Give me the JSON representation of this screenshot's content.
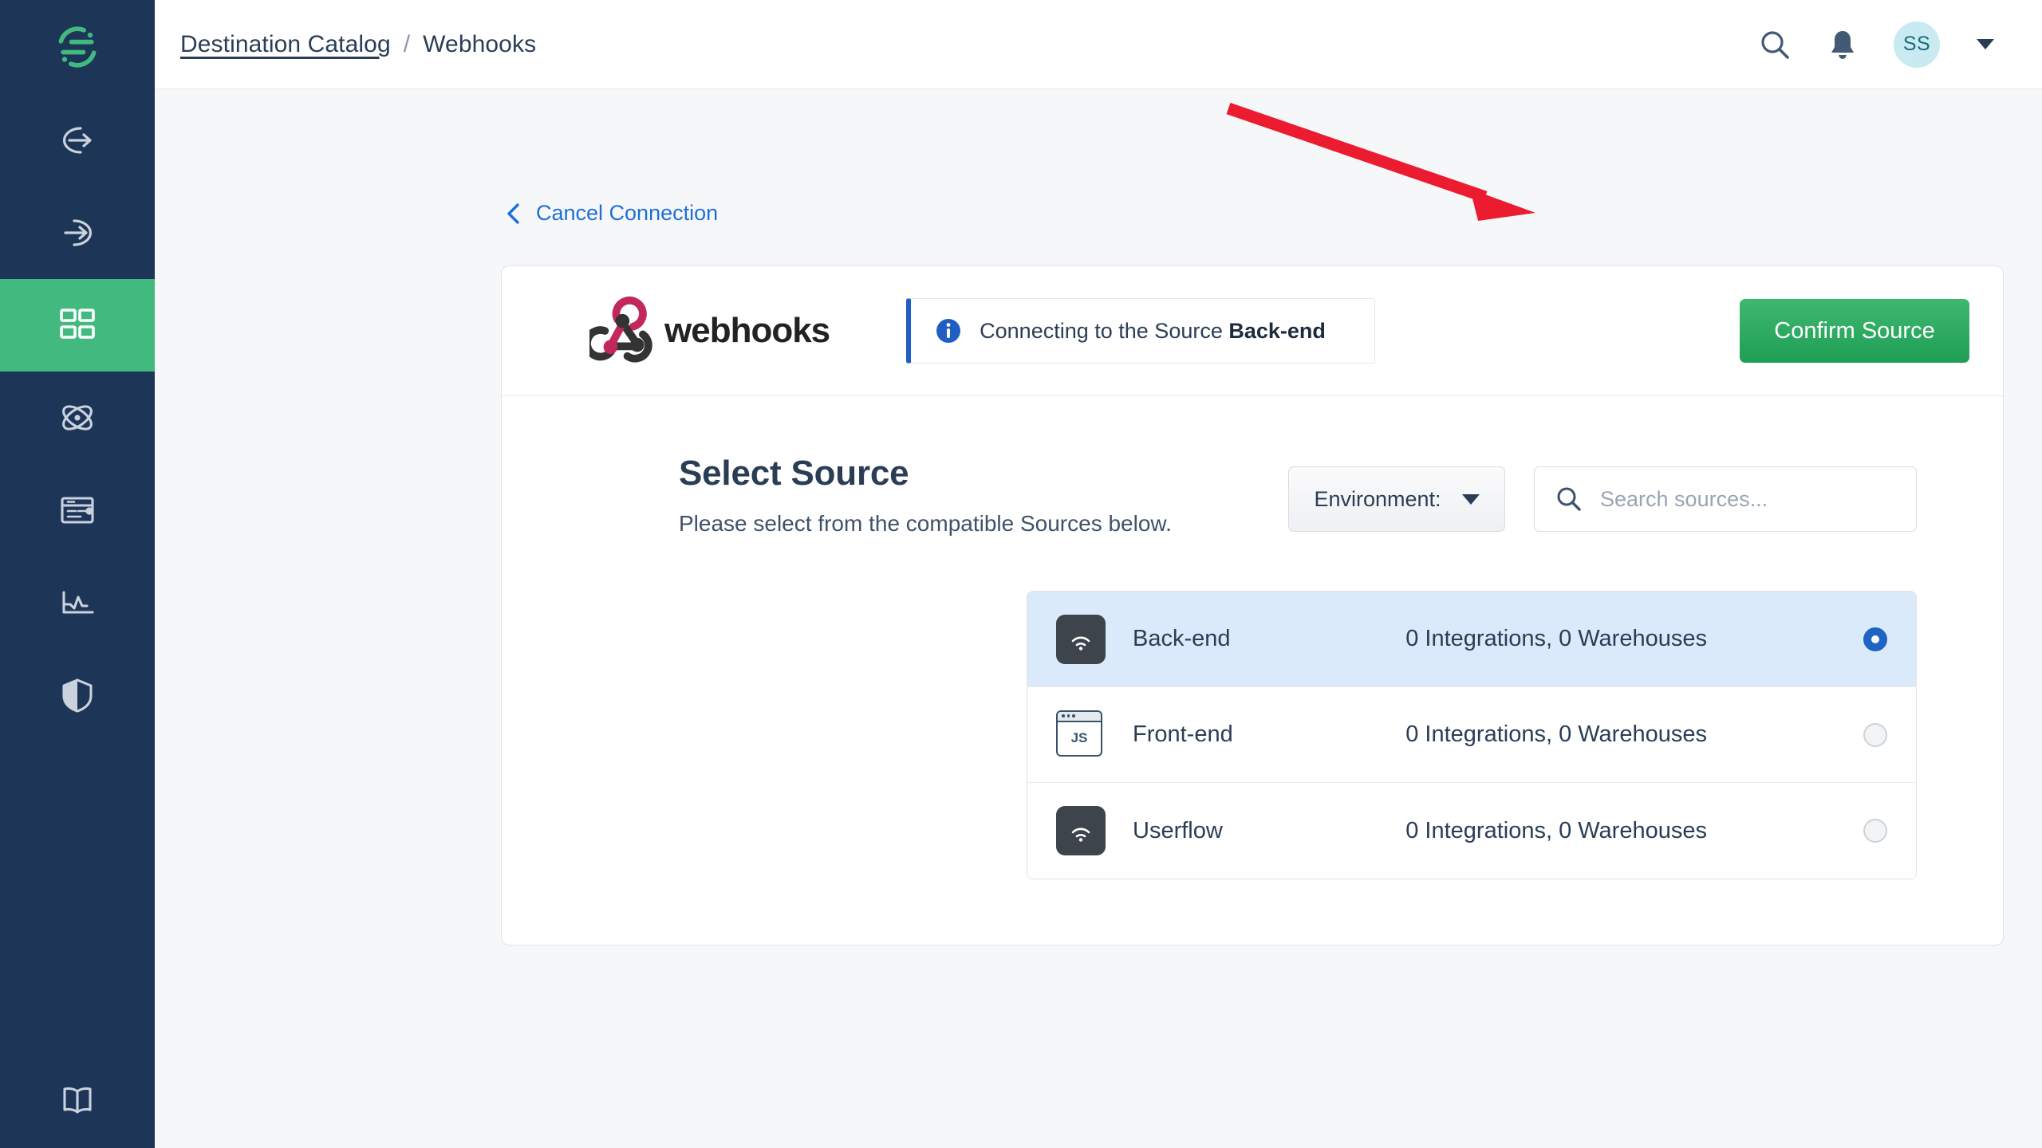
{
  "sidebar": {
    "logo_name": "segment-logo",
    "items": [
      {
        "name": "sources",
        "icon": "arrow-out-circle-icon",
        "active": false
      },
      {
        "name": "destinations",
        "icon": "arrow-in-circle-icon",
        "active": false
      },
      {
        "name": "catalog",
        "icon": "grid-squares-icon",
        "active": true
      },
      {
        "name": "connections",
        "icon": "atom-icon",
        "active": false
      },
      {
        "name": "protocols",
        "icon": "tracking-plan-icon",
        "active": false
      },
      {
        "name": "activity",
        "icon": "line-chart-icon",
        "active": false
      },
      {
        "name": "privacy",
        "icon": "shield-icon",
        "active": false
      }
    ],
    "bottom_item": {
      "name": "docs",
      "icon": "book-icon"
    },
    "active_color": "#41b97f",
    "background_color": "#1d3557"
  },
  "topbar": {
    "breadcrumb": {
      "root_label": "Destination Catalog",
      "separator": "/",
      "current_label": "Webhooks"
    },
    "search_icon": "search-icon",
    "notifications_icon": "bell-icon",
    "avatar_initials": "SS",
    "avatar_bg": "#c9eaf1",
    "avatar_fg": "#1b6b7a",
    "user_menu_icon": "chevron-down-icon"
  },
  "content": {
    "cancel_link_label": "Cancel Connection",
    "cancel_link_color": "#1f6fd8"
  },
  "card": {
    "brand_name": "webhooks",
    "brand_logo_colors": {
      "pink": "#c2285a",
      "dark": "#333333"
    },
    "info_banner": {
      "icon": "info-circle-icon",
      "text_prefix": "Connecting to the Source ",
      "source_name": "Back-end",
      "accent_color": "#1f5fc4"
    },
    "confirm_button_label": "Confirm Source",
    "confirm_button_color": "#2ba35d"
  },
  "select_source": {
    "title": "Select Source",
    "subtitle": "Please select from the compatible Sources below.",
    "environment_filter": {
      "label": "Environment:",
      "icon": "chevron-down-icon"
    },
    "search": {
      "icon": "search-icon",
      "placeholder": "Search sources...",
      "value": ""
    },
    "sources": [
      {
        "name": "Back-end",
        "icon": "server-signal-icon",
        "icon_style": "dark",
        "meta": "0 Integrations, 0 Warehouses",
        "selected": true
      },
      {
        "name": "Front-end",
        "icon": "javascript-browser-icon",
        "icon_style": "js",
        "meta": "0 Integrations, 0 Warehouses",
        "selected": false
      },
      {
        "name": "Userflow",
        "icon": "server-signal-icon",
        "icon_style": "dark",
        "meta": "0 Integrations, 0 Warehouses",
        "selected": false
      }
    ]
  },
  "annotation": {
    "type": "arrow",
    "color": "#ec1c30",
    "points_to": "confirm-source-button"
  }
}
